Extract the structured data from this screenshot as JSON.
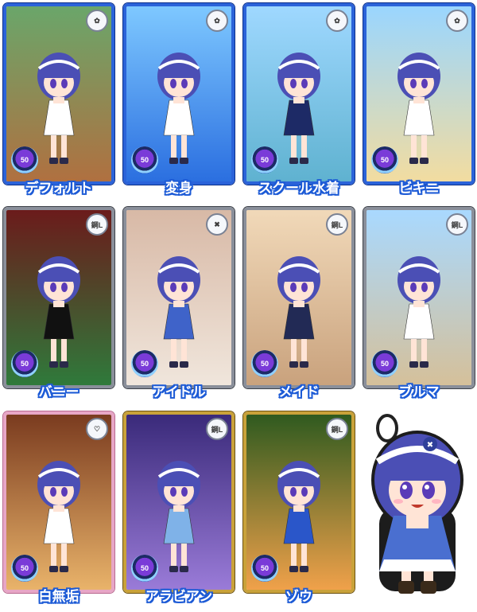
{
  "level_badge": "50",
  "cards": [
    {
      "label": "デフォルト",
      "frame": "blue",
      "emblem": "✿",
      "bg": [
        "#6aa66a",
        "#b07040"
      ],
      "outfit": "#ffffff"
    },
    {
      "label": "変身",
      "frame": "blue",
      "emblem": "✿",
      "bg": [
        "#7ec8ff",
        "#2b6fe0"
      ],
      "outfit": "#ffffff"
    },
    {
      "label": "スクール水着",
      "frame": "blue",
      "emblem": "✿",
      "bg": [
        "#9fd8ff",
        "#5fb2d0"
      ],
      "outfit": "#1d2a66"
    },
    {
      "label": "ビキニ",
      "frame": "blue",
      "emblem": "✿",
      "bg": [
        "#9ad6ff",
        "#f2dca0"
      ],
      "outfit": "#ffffff"
    },
    {
      "label": "バニー",
      "frame": "silver",
      "emblem": "鋼L",
      "bg": [
        "#6b1b1b",
        "#2f7a3b"
      ],
      "outfit": "#111111"
    },
    {
      "label": "アイドル",
      "frame": "silver",
      "emblem": "✖",
      "bg": [
        "#d8b9a6",
        "#f0e6dc"
      ],
      "outfit": "#3f63c9"
    },
    {
      "label": "メイド",
      "frame": "silver",
      "emblem": "鋼L",
      "bg": [
        "#f1d9b9",
        "#c9a27d"
      ],
      "outfit": "#222a55"
    },
    {
      "label": "ブルマ",
      "frame": "silver",
      "emblem": "鋼L",
      "bg": [
        "#a9d9ff",
        "#d5c09a"
      ],
      "outfit": "#ffffff"
    },
    {
      "label": "白無垢",
      "frame": "pink",
      "emblem": "♡",
      "bg": [
        "#7a3b1f",
        "#e9b36a"
      ],
      "outfit": "#ffffff"
    },
    {
      "label": "アラビアン",
      "frame": "gold",
      "emblem": "鋼L",
      "bg": [
        "#3a2a7a",
        "#9a7bd8"
      ],
      "outfit": "#7fb2e8"
    },
    {
      "label": "ゾウ",
      "frame": "gold",
      "emblem": "鋼L",
      "bg": [
        "#2f5a1f",
        "#f0a14a"
      ],
      "outfit": "#2a56c9"
    }
  ],
  "colors": {
    "hair": "#4b4fb5",
    "skin": "#ffe4d6",
    "caption_outline": "#1d5bd6"
  }
}
